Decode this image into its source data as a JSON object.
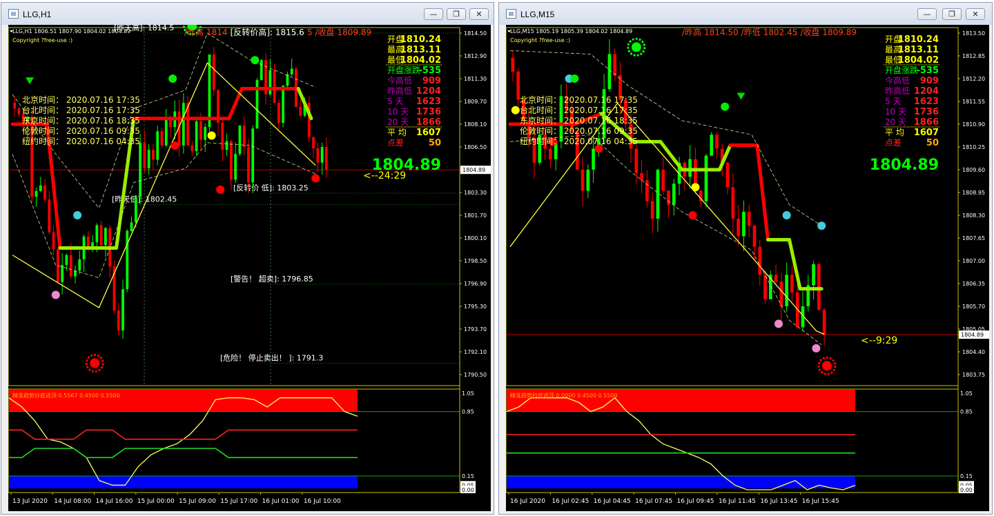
{
  "windows": [
    {
      "title": "LLG,H1",
      "info_line": "LLG,H1  1806.51 1807.90 1804.02 1804.89",
      "copyright": "Copyright ?free-use :)",
      "header": [
        {
          "text": "/昨高",
          "color": "#ff4020"
        },
        {
          "text": "1814",
          "color": "#ff4020"
        },
        {
          "text": "[反转价高]: 1815.6",
          "color": "#ffffff"
        },
        {
          "text": "5",
          "color": "#ff4020"
        },
        {
          "text": "/收盘",
          "color": "#ff4020"
        },
        {
          "text": "1809.89",
          "color": "#ff4020"
        }
      ],
      "stats": [
        {
          "label": "开盘",
          "value": "1810.24",
          "lc": "#ffff00",
          "vc": "#ffff00"
        },
        {
          "label": "最高",
          "value": "1813.11",
          "lc": "#ffff00",
          "vc": "#ffff00"
        },
        {
          "label": "最低",
          "value": "1804.02",
          "lc": "#ffff00",
          "vc": "#ffff00"
        },
        {
          "label": "开盘涨跌",
          "value": "-535",
          "lc": "#00ff00",
          "vc": "#00ff00"
        },
        {
          "label": "今高低",
          "value": "909",
          "lc": "#c000c0",
          "vc": "#ff2020"
        },
        {
          "label": "昨高低",
          "value": "1204",
          "lc": "#c000c0",
          "vc": "#ff2020"
        },
        {
          "label": "5  天",
          "value": "1623",
          "lc": "#c000c0",
          "vc": "#ff2020"
        },
        {
          "label": "10 天",
          "value": "1736",
          "lc": "#c000c0",
          "vc": "#ff2020"
        },
        {
          "label": "20 天",
          "value": "1866",
          "lc": "#c000c0",
          "vc": "#ff2020"
        },
        {
          "label": "平  均",
          "value": "1607",
          "lc": "#ffff00",
          "vc": "#ffff00"
        },
        {
          "label": "点差",
          "value": "50",
          "lc": "#ff2020",
          "vc": "#ffaa00"
        }
      ],
      "price_big": "1804.89",
      "countdown": "<--24:29",
      "times": [
        "北京时间：  2020.07.16 17:35",
        "台北时间：  2020.07.16 17:35",
        "东京时间：  2020.07.16 18:35",
        "伦敦时间：  2020.07.16 09:35",
        "纽约时间：  2020.07.16 04:35"
      ],
      "annotations": [
        {
          "text": "[昨天高]: 1814.5",
          "price": 1814.5
        },
        {
          "text": "[反转价 低]: 1803.25",
          "price": 1803.25
        },
        {
          "text": "[昨天低]: 1802.45",
          "price": 1802.45
        },
        {
          "text": "[警告！ 超卖]: 1796.85",
          "price": 1796.85
        },
        {
          "text": "[危险！ 停止卖出！ ]: 1791.3",
          "price": 1791.3
        }
      ],
      "axis_prices": [
        "1814.50",
        "1812.90",
        "1811.30",
        "1809.70",
        "1808.10",
        "1806.50",
        "1804.89",
        "1803.30",
        "1801.70",
        "1800.10",
        "1798.50",
        "1796.90",
        "1795.30",
        "1793.70",
        "1792.10",
        "1790.50"
      ],
      "current_price": "1804.89",
      "osc_label": "精准趋势抄底逃顶 0.5567 0.4500 0.5500",
      "osc_levels": [
        "1.05",
        "0.85",
        "0.15",
        "0.05",
        "0.00"
      ],
      "time_axis": [
        "13 Jul 2020",
        "14 Jul 08:00",
        "14 Jul 16:00",
        "15 Jul 00:00",
        "15 Jul 09:00",
        "15 Jul 17:00",
        "16 Jul 01:00",
        "16 Jul 10:00"
      ]
    },
    {
      "title": "LLG,M15",
      "info_line": "LLG,M15  1805.19 1805.39 1804.02 1804.89",
      "copyright": "Copyright ?free-use :)",
      "header": [
        {
          "text": "/昨高",
          "color": "#ff4020"
        },
        {
          "text": "1814.50",
          "color": "#ff4020"
        },
        {
          "text": "/昨低",
          "color": "#ff4020"
        },
        {
          "text": "1802.45",
          "color": "#ff4020"
        },
        {
          "text": "/收盘",
          "color": "#ff4020"
        },
        {
          "text": "1809.89",
          "color": "#ff4020"
        }
      ],
      "stats": [
        {
          "label": "开盘",
          "value": "1810.24",
          "lc": "#ffff00",
          "vc": "#ffff00"
        },
        {
          "label": "最高",
          "value": "1813.11",
          "lc": "#ffff00",
          "vc": "#ffff00"
        },
        {
          "label": "最低",
          "value": "1804.02",
          "lc": "#ffff00",
          "vc": "#ffff00"
        },
        {
          "label": "开盘涨跌",
          "value": "-535",
          "lc": "#00ff00",
          "vc": "#00ff00"
        },
        {
          "label": "今高低",
          "value": "909",
          "lc": "#c000c0",
          "vc": "#ff2020"
        },
        {
          "label": "昨高低",
          "value": "1204",
          "lc": "#c000c0",
          "vc": "#ff2020"
        },
        {
          "label": "5  天",
          "value": "1623",
          "lc": "#c000c0",
          "vc": "#ff2020"
        },
        {
          "label": "10 天",
          "value": "1736",
          "lc": "#c000c0",
          "vc": "#ff2020"
        },
        {
          "label": "20 天",
          "value": "1866",
          "lc": "#c000c0",
          "vc": "#ff2020"
        },
        {
          "label": "平  均",
          "value": "1607",
          "lc": "#ffff00",
          "vc": "#ffff00"
        },
        {
          "label": "点差",
          "value": "50",
          "lc": "#ff2020",
          "vc": "#ffaa00"
        }
      ],
      "price_big": "1804.89",
      "countdown": "<--9:29",
      "times": [
        "北京时间：  2020.07.16 17:35",
        "台北时间：  2020.07.16 17:35",
        "东京时间：  2020.07.16 18:35",
        "伦敦时间：  2020.07.16 09:35",
        "纽约时间：  2020.07.16 04:35"
      ],
      "annotations": [],
      "axis_prices": [
        "1813.50",
        "1812.85",
        "1812.20",
        "1811.55",
        "1810.90",
        "1810.25",
        "1809.60",
        "1808.95",
        "1808.30",
        "1807.65",
        "1807.00",
        "1806.35",
        "1805.70",
        "1805.05",
        "1804.40",
        "1803.75"
      ],
      "current_price": "1804.89",
      "osc_label": "精准趋势抄底逃顶 0.0000 0.4500 0.5500",
      "osc_levels": [
        "1.05",
        "0.85",
        "0.15",
        "0.05",
        "0.00"
      ],
      "time_axis": [
        "16 Jul 2020",
        "16 Jul 02:45",
        "16 Jul 04:45",
        "16 Jul 07:45",
        "16 Jul 09:45",
        "16 Jul 11:45",
        "16 Jul 13:45",
        "16 Jul 15:45"
      ]
    }
  ],
  "window_buttons": {
    "minimize": "—",
    "restore": "❐",
    "close": "✕"
  },
  "colors": {
    "bull": "#00ff00",
    "bear": "#ff0000",
    "trend_up": "#99ee00",
    "trend_down": "#ff0000",
    "zigzag": "#ffff40",
    "axis": "#ffff00"
  }
}
